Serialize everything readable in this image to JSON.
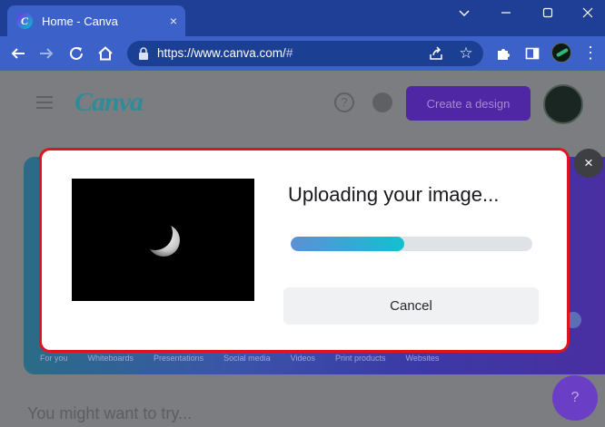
{
  "browser": {
    "tab_title": "Home - Canva",
    "favicon_letter": "C",
    "tab_close": "×",
    "url_main": "https://www.canva.com/",
    "url_hash": "#",
    "icons": [
      "back-arrow-icon",
      "forward-arrow-icon",
      "reload-icon",
      "home-icon",
      "lock-icon",
      "share-icon",
      "star-icon",
      "puzzle-icon",
      "side-panel-icon",
      "profile-avatar",
      "more-vert-icon"
    ],
    "window_controls": [
      "minimize-icon",
      "maximize-icon",
      "close-icon"
    ]
  },
  "background_page": {
    "logo": "Canva",
    "create_button": "Create a design",
    "categories": [
      "For you",
      "Whiteboards",
      "Presentations",
      "Social media",
      "Videos",
      "Print products",
      "Websites"
    ],
    "section_heading": "You might want to try...",
    "fab_label": "?"
  },
  "modal": {
    "title": "Uploading your image...",
    "progress_fraction": 0.47,
    "cancel_label": "Cancel",
    "close_label": "×",
    "image_subject": "moon"
  },
  "colors": {
    "chrome_dark": "#1e3f95",
    "chrome_light": "#3c62c9",
    "modal_border": "#e0141e",
    "progress_start": "#5d8fd6",
    "progress_end": "#11c1cf"
  }
}
